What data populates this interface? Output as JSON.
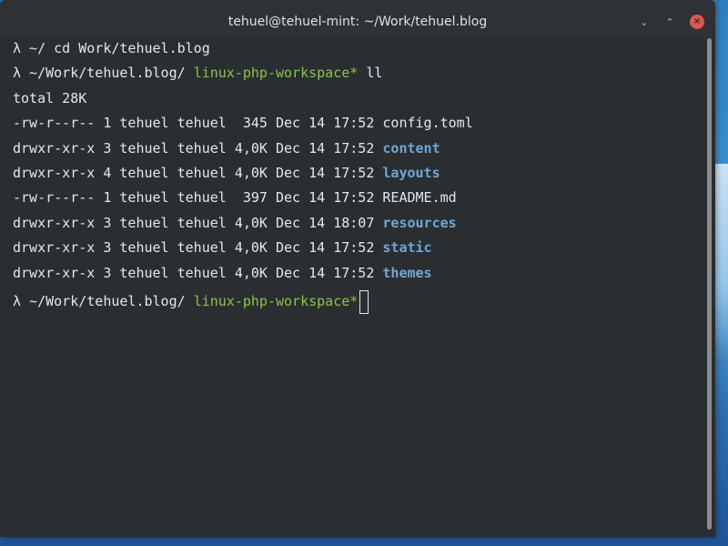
{
  "window": {
    "title": "tehuel@tehuel-mint: ~/Work/tehuel.blog",
    "buttons": {
      "minimize": "⌄",
      "maximize": "⌃",
      "close": "×"
    }
  },
  "terminal": {
    "lines": [
      {
        "prompt": "λ ~/ ",
        "git": "",
        "command": "cd Work/tehuel.blog"
      },
      {
        "prompt": "λ ~/Work/tehuel.blog/ ",
        "git": "linux-php-workspace*",
        "command": " ll"
      },
      {
        "text": "total 28K"
      }
    ],
    "listing": [
      {
        "meta": "-rw-r--r-- 1 tehuel tehuel  345 Dec 14 17:52 ",
        "name": "config.toml",
        "is_dir": false
      },
      {
        "meta": "drwxr-xr-x 3 tehuel tehuel 4,0K Dec 14 17:52 ",
        "name": "content",
        "is_dir": true
      },
      {
        "meta": "drwxr-xr-x 4 tehuel tehuel 4,0K Dec 14 17:52 ",
        "name": "layouts",
        "is_dir": true
      },
      {
        "meta": "-rw-r--r-- 1 tehuel tehuel  397 Dec 14 17:52 ",
        "name": "README.md",
        "is_dir": false
      },
      {
        "meta": "drwxr-xr-x 3 tehuel tehuel 4,0K Dec 14 18:07 ",
        "name": "resources",
        "is_dir": true
      },
      {
        "meta": "drwxr-xr-x 3 tehuel tehuel 4,0K Dec 14 17:52 ",
        "name": "static",
        "is_dir": true
      },
      {
        "meta": "drwxr-xr-x 3 tehuel tehuel 4,0K Dec 14 17:52 ",
        "name": "themes",
        "is_dir": true
      }
    ],
    "final_prompt": {
      "prompt": "λ ~/Work/tehuel.blog/ ",
      "git": "linux-php-workspace*"
    }
  },
  "colors": {
    "background": "#2b2e30",
    "text": "#e6e6e6",
    "directory": "#6ea6d8",
    "git_branch": "#8bc34a",
    "close_button": "#e0554d"
  },
  "icons": {
    "minimize": "chevron-down-icon",
    "maximize": "chevron-up-icon",
    "close": "close-icon"
  }
}
